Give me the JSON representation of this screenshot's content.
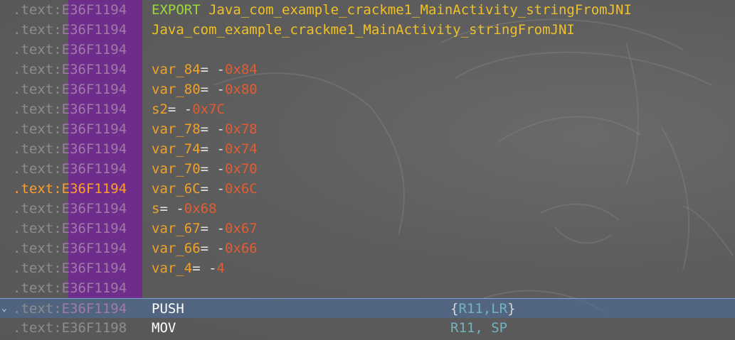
{
  "theme": {
    "background": "#5b5b5b",
    "address_segment_color": "#8d8d8d",
    "address_offset_bg": "#6e2d8a",
    "active_address_color": "#ff9d2e",
    "export_color": "#9ed83a",
    "symbol_color": "#f0c028",
    "variable_color": "#f0a226",
    "number_color": "#e05d33",
    "register_color": "#72b3bf",
    "selection_color": "#4a70a0"
  },
  "listing": {
    "lines": [
      {
        "segment": ".text:",
        "offset": "E36F1194",
        "kind": "export",
        "keyword": "EXPORT",
        "symbol": "Java_com_example_crackme1_MainActivity_stringFromJNI"
      },
      {
        "segment": ".text:",
        "offset": "E36F1194",
        "kind": "label",
        "symbol": "Java_com_example_crackme1_MainActivity_stringFromJNI"
      },
      {
        "segment": ".text:",
        "offset": "E36F1194",
        "kind": "blank"
      },
      {
        "segment": ".text:",
        "offset": "E36F1194",
        "kind": "var",
        "name": "var_84",
        "eq": "=",
        "minus": " -",
        "value": "0x84"
      },
      {
        "segment": ".text:",
        "offset": "E36F1194",
        "kind": "var",
        "name": "var_80",
        "eq": "=",
        "minus": " -",
        "value": "0x80"
      },
      {
        "segment": ".text:",
        "offset": "E36F1194",
        "kind": "var",
        "name": "s2",
        "eq": "=",
        "minus": " -",
        "value": "0x7C"
      },
      {
        "segment": ".text:",
        "offset": "E36F1194",
        "kind": "var",
        "name": "var_78",
        "eq": "=",
        "minus": " -",
        "value": "0x78"
      },
      {
        "segment": ".text:",
        "offset": "E36F1194",
        "kind": "var",
        "name": "var_74",
        "eq": "=",
        "minus": " -",
        "value": "0x74"
      },
      {
        "segment": ".text:",
        "offset": "E36F1194",
        "kind": "var",
        "name": "var_70",
        "eq": "=",
        "minus": " -",
        "value": "0x70"
      },
      {
        "segment": ".text:",
        "offset": "E36F1194",
        "kind": "var",
        "name": "var_6C",
        "eq": "=",
        "minus": " -",
        "value": "0x6C",
        "active": true
      },
      {
        "segment": ".text:",
        "offset": "E36F1194",
        "kind": "var",
        "name": "s",
        "eq": "=",
        "minus": " -",
        "value": "0x68"
      },
      {
        "segment": ".text:",
        "offset": "E36F1194",
        "kind": "var",
        "name": "var_67",
        "eq": "=",
        "minus": " -",
        "value": "0x67"
      },
      {
        "segment": ".text:",
        "offset": "E36F1194",
        "kind": "var",
        "name": "var_66",
        "eq": "=",
        "minus": " -",
        "value": "0x66"
      },
      {
        "segment": ".text:",
        "offset": "E36F1194",
        "kind": "var",
        "name": "var_4",
        "eq": "=",
        "minus": " -",
        "value": "4"
      },
      {
        "segment": ".text:",
        "offset": "E36F1194",
        "kind": "blank"
      },
      {
        "segment": ".text:",
        "offset": "E36F1194",
        "kind": "insn",
        "mnemonic": "PUSH",
        "brace_open": "{",
        "operands": "R11,LR",
        "brace_close": "}",
        "selected": true,
        "fold": "⌄"
      },
      {
        "segment": ".text:",
        "offset": "E36F1198",
        "kind": "insn",
        "mnemonic": "MOV",
        "brace_open": "",
        "operands": "R11, SP",
        "brace_close": "",
        "plain": true
      }
    ]
  }
}
